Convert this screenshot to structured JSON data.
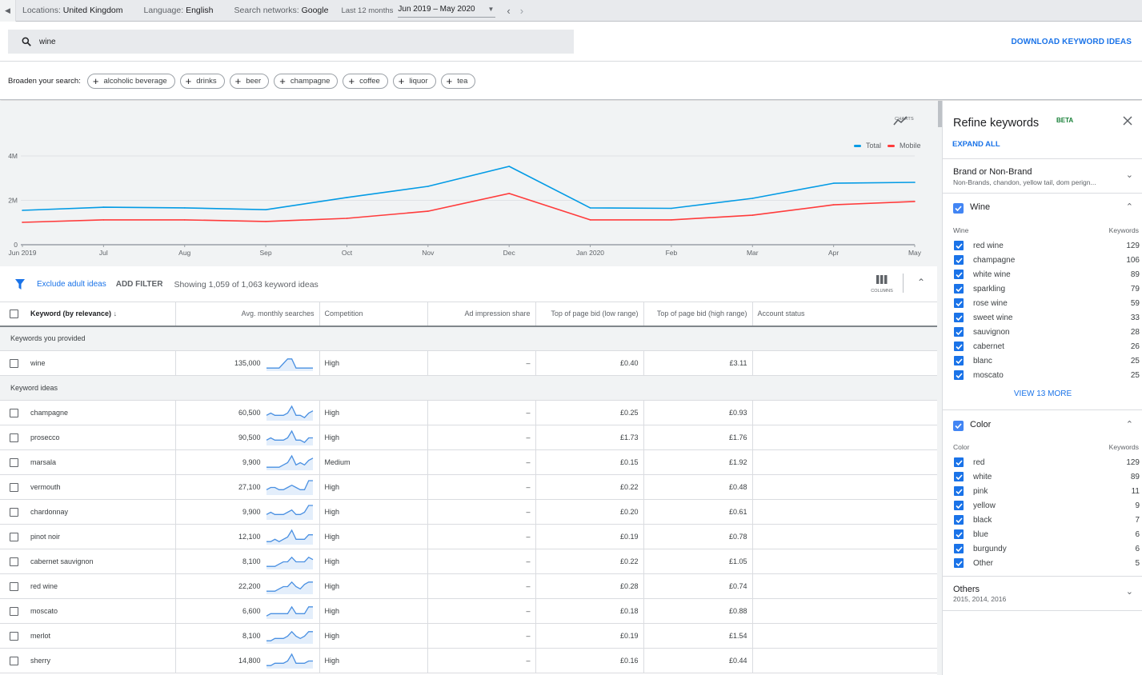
{
  "topbar": {
    "locations_label": "Locations:",
    "locations_value": "United Kingdom",
    "language_label": "Language:",
    "language_value": "English",
    "networks_label": "Search networks:",
    "networks_value": "Google",
    "period_label": "Last 12 months",
    "date_range": "Jun 2019 – May 2020"
  },
  "search": {
    "query": "wine",
    "download_label": "DOWNLOAD KEYWORD IDEAS"
  },
  "broaden": {
    "label": "Broaden your search:",
    "chips": [
      "alcoholic beverage",
      "drinks",
      "beer",
      "champagne",
      "coffee",
      "liquor",
      "tea"
    ]
  },
  "chart_toolbar": {
    "charts_label": "CHARTS"
  },
  "chart_data": {
    "type": "line",
    "title": "",
    "xlabel": "",
    "ylabel": "",
    "x": [
      "Jun 2019",
      "Jul",
      "Aug",
      "Sep",
      "Oct",
      "Nov",
      "Dec",
      "Jan 2020",
      "Feb",
      "Mar",
      "Apr",
      "May"
    ],
    "y_ticks": [
      "0",
      "2M",
      "4M"
    ],
    "ylim": [
      0,
      4000000
    ],
    "grid": true,
    "legend_position": "top-right",
    "series": [
      {
        "name": "Total",
        "color": "#039be5",
        "values": [
          1550000,
          1690000,
          1660000,
          1580000,
          2130000,
          2630000,
          3530000,
          1660000,
          1640000,
          2090000,
          2770000,
          2810000
        ]
      },
      {
        "name": "Mobile",
        "color": "#ff3b3b",
        "values": [
          1010000,
          1120000,
          1120000,
          1050000,
          1190000,
          1510000,
          2310000,
          1120000,
          1120000,
          1330000,
          1800000,
          1950000
        ]
      }
    ]
  },
  "filterbar": {
    "exclude_label": "Exclude adult ideas",
    "add_filter_label": "ADD FILTER",
    "showing_text": "Showing 1,059 of 1,063 keyword ideas",
    "columns_label": "COLUMNS"
  },
  "table": {
    "headers": [
      "Keyword (by relevance)",
      "Avg. monthly searches",
      "Competition",
      "Ad impression share",
      "Top of page bid (low range)",
      "Top of page bid (high range)",
      "Account status"
    ],
    "provided_group_label": "Keywords you provided",
    "provided": [
      {
        "keyword": "wine",
        "searches": "135,000",
        "trend": [
          1,
          1,
          1,
          1,
          3,
          5,
          5,
          1,
          1,
          1,
          1,
          1
        ],
        "competition": "High",
        "impression_share": "–",
        "bid_low": "£0.40",
        "bid_high": "£3.11",
        "status": ""
      }
    ],
    "ideas_group_label": "Keyword ideas",
    "ideas": [
      {
        "keyword": "champagne",
        "searches": "60,500",
        "trend": [
          2,
          3,
          2,
          2,
          2,
          3,
          6,
          2,
          2,
          1,
          3,
          4
        ],
        "competition": "High",
        "impression_share": "–",
        "bid_low": "£0.25",
        "bid_high": "£0.93",
        "status": ""
      },
      {
        "keyword": "prosecco",
        "searches": "90,500",
        "trend": [
          2,
          3,
          2,
          2,
          2,
          3,
          6,
          2,
          2,
          1,
          3,
          3
        ],
        "competition": "High",
        "impression_share": "–",
        "bid_low": "£1.73",
        "bid_high": "£1.76",
        "status": ""
      },
      {
        "keyword": "marsala",
        "searches": "9,900",
        "trend": [
          1,
          1,
          1,
          1,
          2,
          3,
          6,
          2,
          3,
          2,
          4,
          5
        ],
        "competition": "Medium",
        "impression_share": "–",
        "bid_low": "£0.15",
        "bid_high": "£1.92",
        "status": ""
      },
      {
        "keyword": "vermouth",
        "searches": "27,100",
        "trend": [
          2,
          3,
          3,
          2,
          2,
          3,
          4,
          3,
          2,
          2,
          6,
          6
        ],
        "competition": "High",
        "impression_share": "–",
        "bid_low": "£0.22",
        "bid_high": "£0.48",
        "status": ""
      },
      {
        "keyword": "chardonnay",
        "searches": "9,900",
        "trend": [
          2,
          3,
          2,
          2,
          2,
          3,
          4,
          2,
          2,
          3,
          6,
          6
        ],
        "competition": "High",
        "impression_share": "–",
        "bid_low": "£0.20",
        "bid_high": "£0.61",
        "status": ""
      },
      {
        "keyword": "pinot noir",
        "searches": "12,100",
        "trend": [
          1,
          1,
          2,
          1,
          2,
          3,
          6,
          2,
          2,
          2,
          4,
          4
        ],
        "competition": "High",
        "impression_share": "–",
        "bid_low": "£0.19",
        "bid_high": "£0.78",
        "status": ""
      },
      {
        "keyword": "cabernet sauvignon",
        "searches": "8,100",
        "trend": [
          1,
          1,
          1,
          2,
          3,
          3,
          5,
          3,
          3,
          3,
          5,
          4
        ],
        "competition": "High",
        "impression_share": "–",
        "bid_low": "£0.22",
        "bid_high": "£1.05",
        "status": ""
      },
      {
        "keyword": "red wine",
        "searches": "22,200",
        "trend": [
          1,
          1,
          1,
          2,
          3,
          3,
          5,
          3,
          2,
          4,
          5,
          5
        ],
        "competition": "High",
        "impression_share": "–",
        "bid_low": "£0.28",
        "bid_high": "£0.74",
        "status": ""
      },
      {
        "keyword": "moscato",
        "searches": "6,600",
        "trend": [
          1,
          2,
          2,
          2,
          2,
          2,
          5,
          2,
          2,
          2,
          5,
          5
        ],
        "competition": "High",
        "impression_share": "–",
        "bid_low": "£0.18",
        "bid_high": "£0.88",
        "status": ""
      },
      {
        "keyword": "merlot",
        "searches": "8,100",
        "trend": [
          1,
          1,
          2,
          2,
          2,
          3,
          5,
          3,
          2,
          3,
          5,
          5
        ],
        "competition": "High",
        "impression_share": "–",
        "bid_low": "£0.19",
        "bid_high": "£1.54",
        "status": ""
      },
      {
        "keyword": "sherry",
        "searches": "14,800",
        "trend": [
          1,
          1,
          2,
          2,
          2,
          3,
          6,
          2,
          2,
          2,
          3,
          3
        ],
        "competition": "High",
        "impression_share": "–",
        "bid_low": "£0.16",
        "bid_high": "£0.44",
        "status": ""
      }
    ]
  },
  "refine": {
    "title": "Refine keywords",
    "beta": "BETA",
    "expand_all": "EXPAND ALL",
    "brand": {
      "title": "Brand or Non-Brand",
      "subtitle": "Non-Brands, chandon, yellow tail, dom perign..."
    },
    "wine": {
      "title": "Wine",
      "col_left": "Wine",
      "col_right": "Keywords",
      "options": [
        {
          "label": "red wine",
          "count": "129"
        },
        {
          "label": "champagne",
          "count": "106"
        },
        {
          "label": "white wine",
          "count": "89"
        },
        {
          "label": "sparkling",
          "count": "79"
        },
        {
          "label": "rose wine",
          "count": "59"
        },
        {
          "label": "sweet wine",
          "count": "33"
        },
        {
          "label": "sauvignon",
          "count": "28"
        },
        {
          "label": "cabernet",
          "count": "26"
        },
        {
          "label": "blanc",
          "count": "25"
        },
        {
          "label": "moscato",
          "count": "25"
        }
      ],
      "view_more": "VIEW 13 MORE"
    },
    "color": {
      "title": "Color",
      "col_left": "Color",
      "col_right": "Keywords",
      "options": [
        {
          "label": "red",
          "count": "129"
        },
        {
          "label": "white",
          "count": "89"
        },
        {
          "label": "pink",
          "count": "11"
        },
        {
          "label": "yellow",
          "count": "9"
        },
        {
          "label": "black",
          "count": "7"
        },
        {
          "label": "blue",
          "count": "6"
        },
        {
          "label": "burgundy",
          "count": "6"
        },
        {
          "label": "Other",
          "count": "5"
        }
      ]
    },
    "others": {
      "title": "Others",
      "subtitle": "2015, 2014, 2016"
    }
  }
}
